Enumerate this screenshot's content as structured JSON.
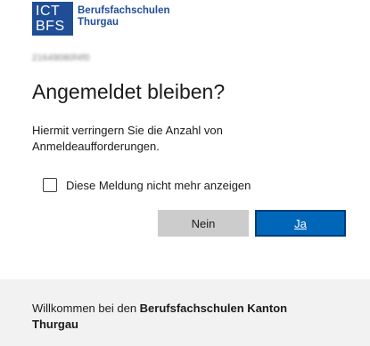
{
  "logo": {
    "box_line1": "ICT",
    "box_line2": "BFS",
    "text_line1": "Berufsfachschulen",
    "text_line2": "Thurgau",
    "brand_color": "#1f4e96"
  },
  "account": {
    "blurred_text": "21649080f4f0"
  },
  "page": {
    "title": "Angemeldet bleiben?",
    "description": "Hiermit verringern Sie die Anzahl von Anmeldeaufforderungen."
  },
  "checkbox": {
    "label": "Diese Meldung nicht mehr anzeigen",
    "checked": false
  },
  "buttons": {
    "no_label": "Nein",
    "yes_label": "Ja",
    "yes_color": "#0067b8"
  },
  "footer": {
    "text_prefix": "Willkommen bei den ",
    "text_bold": "Berufsfachschulen Kanton Thurgau",
    "background": "#f2f2f2"
  }
}
